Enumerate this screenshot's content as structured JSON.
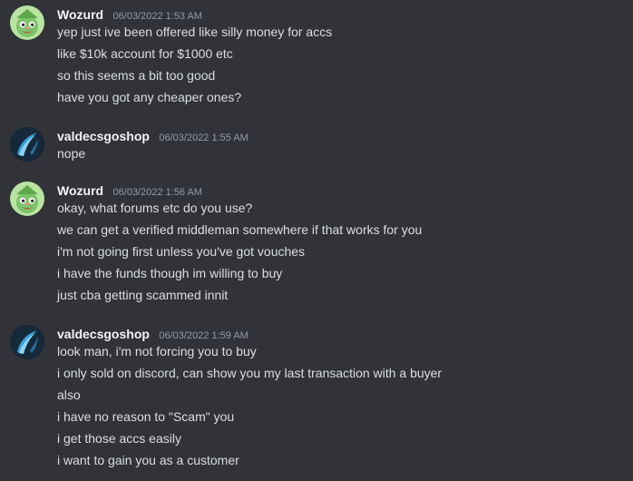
{
  "messages": [
    {
      "author": "Wozurd",
      "avatar_icon": "green-goblin-avatar-icon",
      "timestamp": "06/03/2022 1:53 AM",
      "lines": [
        "yep just ive been offered like silly money for accs",
        "like $10k account for $1000 etc",
        "so this seems a bit too good",
        "have you got any cheaper ones?"
      ]
    },
    {
      "author": "valdecsgoshop",
      "avatar_icon": "blue-blade-avatar-icon",
      "timestamp": "06/03/2022 1:55 AM",
      "lines": [
        "nope"
      ]
    },
    {
      "author": "Wozurd",
      "avatar_icon": "green-goblin-avatar-icon",
      "timestamp": "06/03/2022 1:56 AM",
      "lines": [
        "okay, what forums etc do you use?",
        "we can get a verified middleman somewhere if that works for you",
        "i'm not going first unless you've got vouches",
        "i have the funds though im willing to buy",
        "just cba getting scammed innit"
      ]
    },
    {
      "author": "valdecsgoshop",
      "avatar_icon": "blue-blade-avatar-icon",
      "timestamp": "06/03/2022 1:59 AM",
      "lines": [
        "look man, i'm not forcing you to buy",
        "i only sold on discord, can show you my last transaction with a buyer",
        "also",
        "i have no reason to \"Scam\" you",
        "i get those accs easily",
        "i want to gain you as a customer"
      ]
    }
  ]
}
